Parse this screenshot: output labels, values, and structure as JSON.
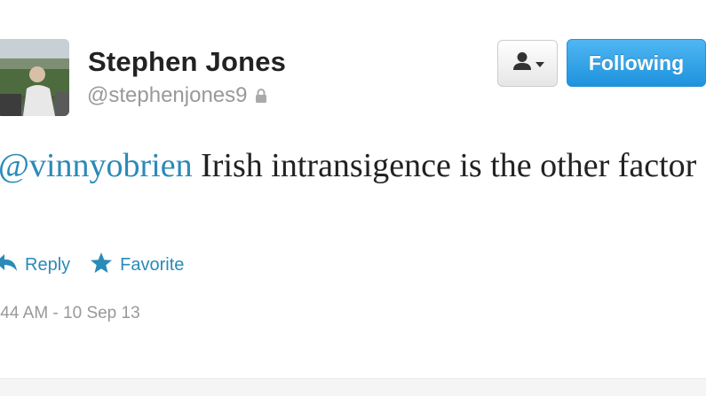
{
  "profile": {
    "display_name": "Stephen Jones",
    "handle": "@stephenjones9",
    "protected_icon": "lock-icon",
    "avatar_icon": "profile-photo"
  },
  "buttons": {
    "user_menu_icon": "person-icon",
    "following_label": "Following",
    "following_color": "#1e93dd"
  },
  "tweet": {
    "mention": "@vinnyobrien",
    "text": " Irish intransigence is the other factor",
    "mention_color": "#2a8ab8"
  },
  "actions": {
    "reply_label": "Reply",
    "reply_icon": "reply-arrow-icon",
    "favorite_label": "Favorite",
    "favorite_icon": "star-icon"
  },
  "meta": {
    "timestamp": ":44 AM - 10 Sep 13"
  }
}
